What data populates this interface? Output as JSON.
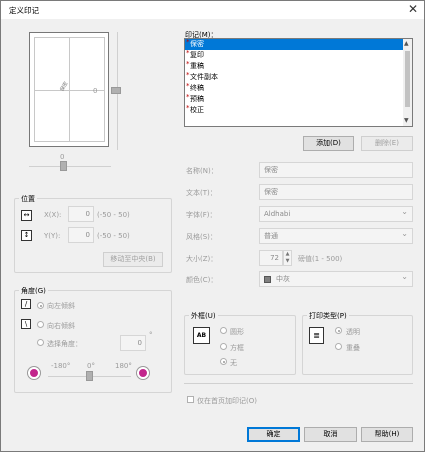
{
  "window": {
    "title": "定义印记",
    "close_glyph": "✕"
  },
  "preview": {
    "mark": "保密"
  },
  "position": {
    "header": "位置",
    "x_label": "X(X):",
    "x_value": "0",
    "x_range": "(-50 - 50)",
    "y_label": "Y(Y):",
    "y_value": "0",
    "y_range": "(-50 - 50)",
    "center_button": "移动至中央(B)",
    "slider_value": "0",
    "vslider_value": "0"
  },
  "angle": {
    "header": "角度(G)",
    "left": "向左倾斜",
    "right": "向右倾斜",
    "select": "选择角度：",
    "value": "0",
    "degree": "°",
    "min": "-180°",
    "mid": "0°",
    "max": "180°"
  },
  "stamps": {
    "header": "印记(M)：",
    "items": [
      "保密",
      "复印",
      "重稿",
      "文件副本",
      "终稿",
      "预稿",
      "校正"
    ]
  },
  "buttons": {
    "add": "添加(D)",
    "delete": "删除(E)",
    "ok": "确定",
    "cancel": "取消",
    "help": "帮助(H)"
  },
  "form": {
    "name_label": "名称(N)：",
    "name_value": "保密",
    "text_label": "文本(T)：",
    "text_value": "保密",
    "font_label": "字体(F)：",
    "font_value": "Aldhabi",
    "style_label": "风格(S)：",
    "style_value": "普通",
    "size_label": "大小(Z)：",
    "size_value": "72",
    "size_range": "磅值(1 - 500)",
    "color_label": "颜色(C)：",
    "color_value": "中灰"
  },
  "frame": {
    "header": "外框(U)",
    "icon_text": "AB",
    "opt1": "圆形",
    "opt2": "方框",
    "opt3": "无"
  },
  "print_type": {
    "header": "打印类型(P)",
    "opt1": "透明",
    "opt2": "重叠"
  },
  "first_page_only": "仅在首页加印记(O)"
}
